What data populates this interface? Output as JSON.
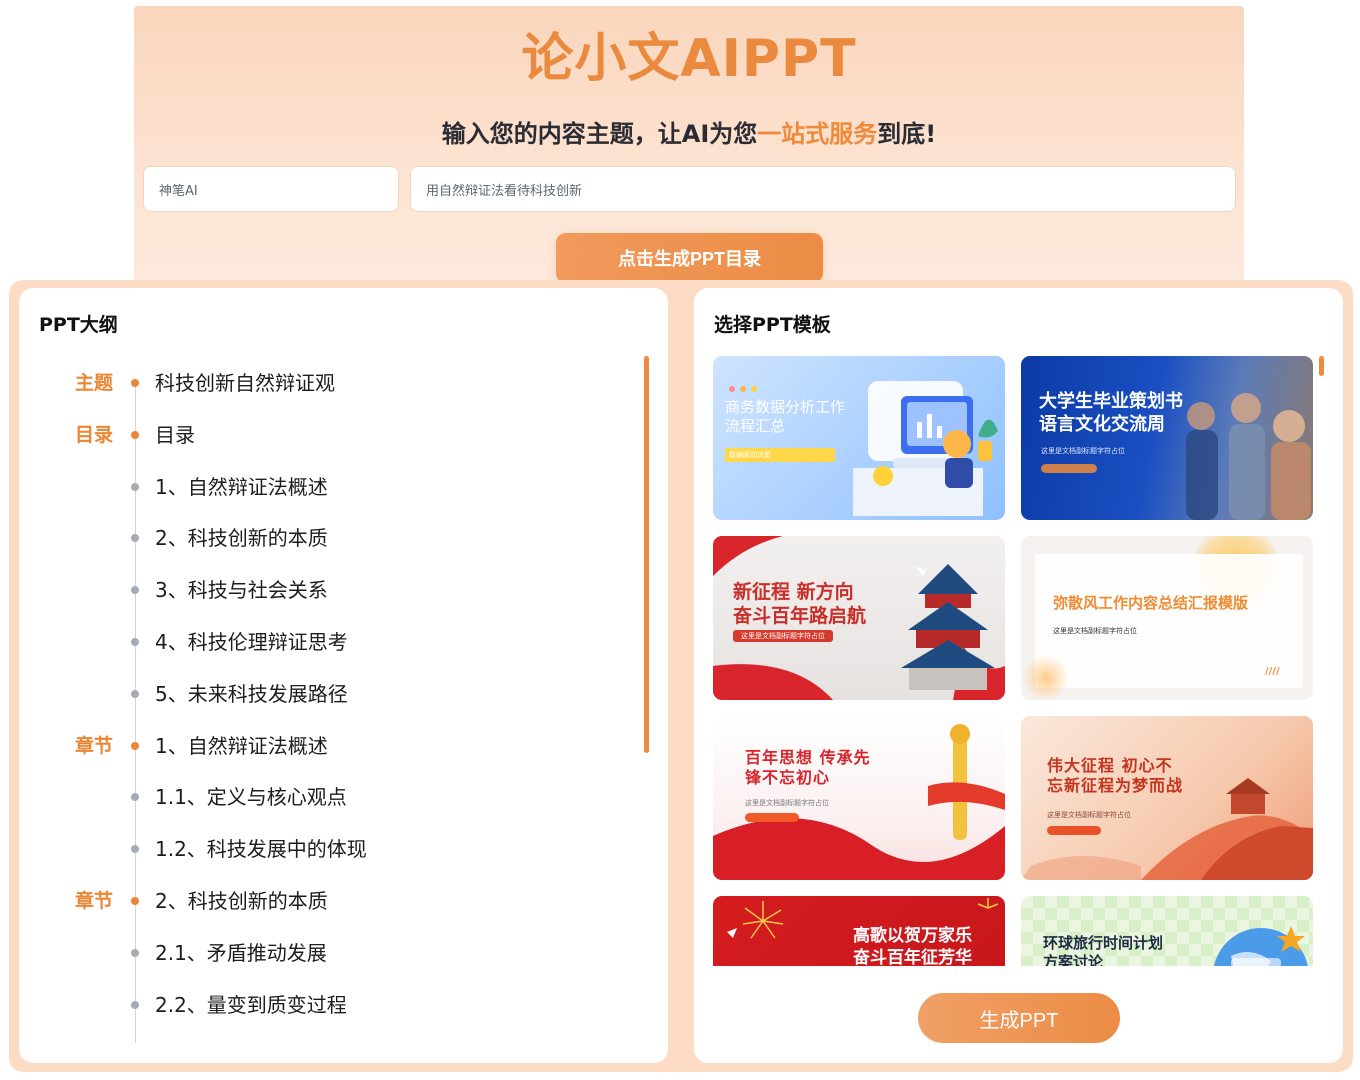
{
  "hero": {
    "title": "论小文AIPPT",
    "subtitle_before": "输入您的内容主题，让AI为您",
    "subtitle_highlight": "一站式服务",
    "subtitle_after": "到底!",
    "model_input_value": "神笔AI",
    "topic_input_value": "用自然辩证法看待科技创新",
    "generate_outline_label": "点击生成PPT目录"
  },
  "outline": {
    "heading": "PPT大纲",
    "rows": [
      {
        "tag": "主题",
        "text": "科技创新自然辩证观"
      },
      {
        "tag": "目录",
        "text": "目录"
      },
      {
        "tag": "",
        "text": "1、自然辩证法概述"
      },
      {
        "tag": "",
        "text": "2、科技创新的本质"
      },
      {
        "tag": "",
        "text": "3、科技与社会关系"
      },
      {
        "tag": "",
        "text": "4、科技伦理辩证思考"
      },
      {
        "tag": "",
        "text": "5、未来科技发展路径"
      },
      {
        "tag": "章节",
        "text": "1、自然辩证法概述"
      },
      {
        "tag": "",
        "text": "1.1、定义与核心观点"
      },
      {
        "tag": "",
        "text": "1.2、科技发展中的体现"
      },
      {
        "tag": "章节",
        "text": "2、科技创新的本质"
      },
      {
        "tag": "",
        "text": "2.1、矛盾推动发展"
      },
      {
        "tag": "",
        "text": "2.2、量变到质变过程"
      }
    ]
  },
  "templates": {
    "heading": "选择PPT模板",
    "items": [
      {
        "title": "商务数据分析工作\n流程汇总",
        "sub": "数据驱动决策"
      },
      {
        "title": "大学生毕业策划书\n语言文化交流周",
        "sub": "这里是文档副标题字符占位"
      },
      {
        "title": "新征程 新方向\n奋斗百年路启航",
        "sub": "这里是文档副标题字符占位"
      },
      {
        "title": "弥散风工作内容总结汇报模版",
        "sub": "这里是文档副标题字符占位"
      },
      {
        "title": "百年思想 传承先\n锋不忘初心",
        "sub": "这里是文档副标题字符占位"
      },
      {
        "title": "伟大征程 初心不\n忘新征程为梦而战",
        "sub": "这里是文档副标题字符占位"
      },
      {
        "title": "高歌以贺万家乐\n奋斗百年征芳华",
        "sub": ""
      },
      {
        "title": "环球旅行时间计划\n方案讨论",
        "sub": ""
      }
    ],
    "generate_label": "生成PPT"
  },
  "colors": {
    "accent": "#ec8534",
    "hero_bg": "#fad6bd",
    "frame_bg": "#fcdcc4"
  }
}
